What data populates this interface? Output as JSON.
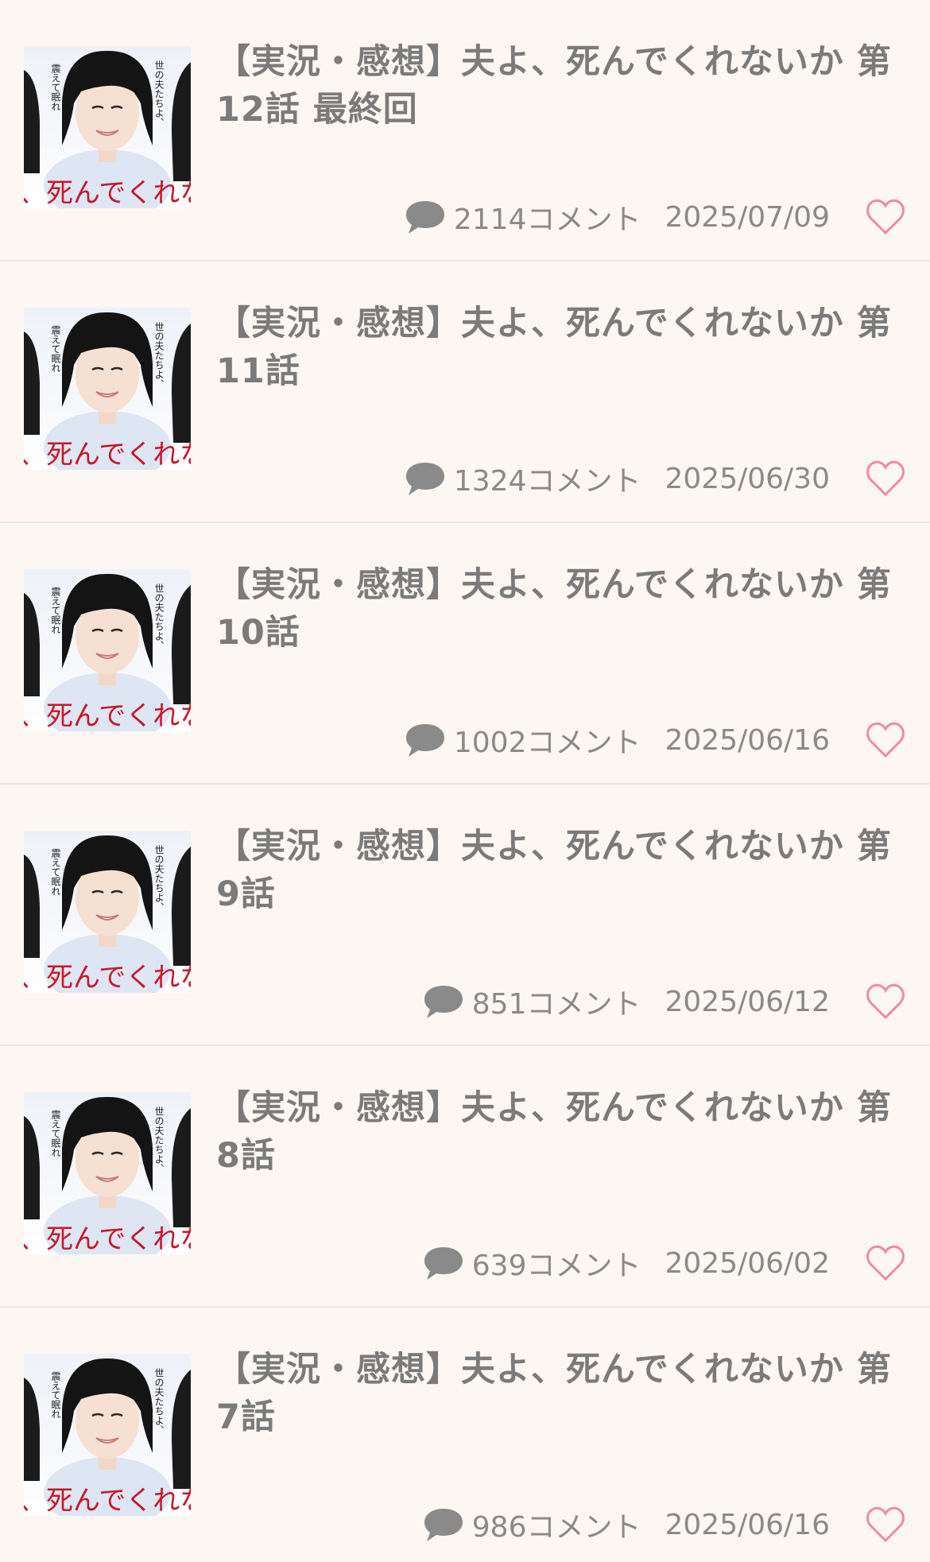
{
  "items": [
    {
      "title": "【実況・感想】夫よ、死んでくれないか 第12話 最終回",
      "comments": "2114コメント",
      "date": "2025/07/09",
      "thumb_text_vertical_left": "震えて眠れ",
      "thumb_text_vertical_right": "世の夫たちよ、",
      "thumb_text_bottom": "、死んでくれな"
    },
    {
      "title": "【実況・感想】夫よ、死んでくれないか 第11話",
      "comments": "1324コメント",
      "date": "2025/06/30",
      "thumb_text_vertical_left": "震えて眠れ",
      "thumb_text_vertical_right": "世の夫たちよ、",
      "thumb_text_bottom": "、死んでくれな"
    },
    {
      "title": "【実況・感想】夫よ、死んでくれないか 第10話",
      "comments": "1002コメント",
      "date": "2025/06/16",
      "thumb_text_vertical_left": "震えて眠れ",
      "thumb_text_vertical_right": "世の夫たちよ、",
      "thumb_text_bottom": "、死んでくれな"
    },
    {
      "title": "【実況・感想】夫よ、死んでくれないか 第9話",
      "comments": "851コメント",
      "date": "2025/06/12",
      "thumb_text_vertical_left": "震えて眠れ",
      "thumb_text_vertical_right": "世の夫たちよ、",
      "thumb_text_bottom": "、死んでくれな"
    },
    {
      "title": "【実況・感想】夫よ、死んでくれないか 第8話",
      "comments": "639コメント",
      "date": "2025/06/02",
      "thumb_text_vertical_left": "震えて眠れ",
      "thumb_text_vertical_right": "世の夫たちよ、",
      "thumb_text_bottom": "、死んでくれな"
    },
    {
      "title": "【実況・感想】夫よ、死んでくれないか 第7話",
      "comments": "986コメント",
      "date": "2025/06/16",
      "thumb_text_vertical_left": "震えて眠れ",
      "thumb_text_vertical_right": "世の夫たちよ、",
      "thumb_text_bottom": "、死んでくれな"
    }
  ],
  "icons": {
    "comment": "comment-icon",
    "favorite": "heart-outline-icon"
  },
  "colors": {
    "background": "#fcf7f2",
    "text": "#7b7b7b",
    "heart": "#f08aa0",
    "thumb_red": "#c8172b"
  }
}
